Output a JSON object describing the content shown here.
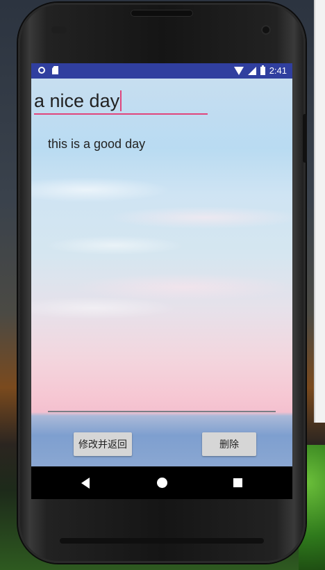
{
  "status_bar": {
    "time": "2:41",
    "icons": [
      "ring-icon",
      "sd-card-icon",
      "wifi-icon",
      "signal-icon",
      "battery-icon"
    ]
  },
  "editor": {
    "title_value": "a nice day",
    "content_text": "this is a good day"
  },
  "buttons": {
    "save_label": "修改并返回",
    "delete_label": "删除"
  },
  "navigation": {
    "icons": [
      "back-icon",
      "home-icon",
      "recents-icon"
    ]
  },
  "colors": {
    "status_bar": "#303f9f",
    "accent": "#e0457b"
  }
}
